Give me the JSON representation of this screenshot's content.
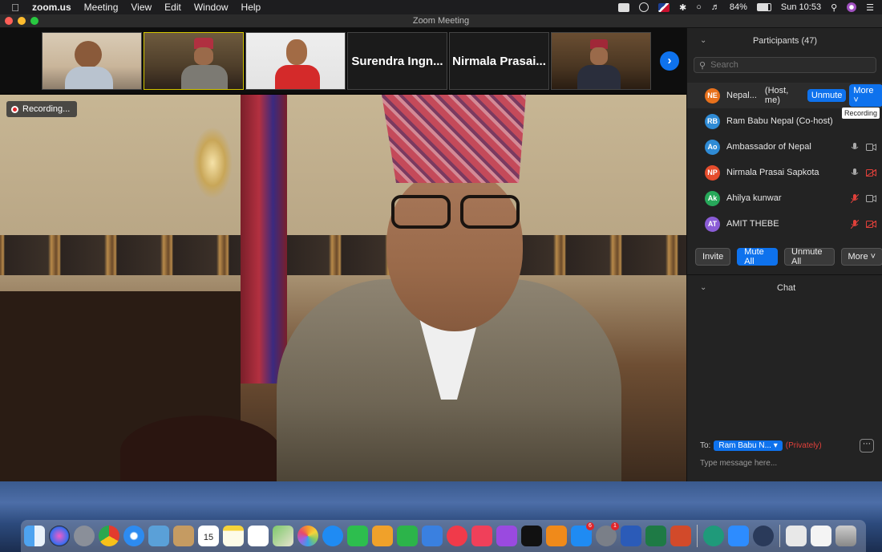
{
  "menubar": {
    "app": "zoom.us",
    "items": [
      "Meeting",
      "View",
      "Edit",
      "Window",
      "Help"
    ],
    "battery": "84%",
    "clock": "Sun 10:53"
  },
  "window": {
    "title": "Zoom Meeting"
  },
  "thumbnails": [
    {
      "label": ""
    },
    {
      "label": ""
    },
    {
      "label": ""
    },
    {
      "label": "Surendra Ingn..."
    },
    {
      "label": "Nirmala Prasai..."
    },
    {
      "label": ""
    }
  ],
  "recording": {
    "label": "Recording..."
  },
  "participants": {
    "header": "Participants (47)",
    "search_placeholder": "Search",
    "rows": [
      {
        "initials": "NE",
        "name": "Nepal...",
        "role": "(Host, me)",
        "color": "#e8711c"
      },
      {
        "initials": "RB",
        "name": "Ram Babu Nepal (Co-host)",
        "role": "",
        "color": "#2f8bd5"
      },
      {
        "initials": "Ao",
        "name": "Ambassador of Nepal",
        "role": "",
        "color": "#2f8bd5"
      },
      {
        "initials": "NP",
        "name": "Nirmala Prasai Sapkota",
        "role": "",
        "color": "#e54c2c"
      },
      {
        "initials": "Ak",
        "name": "Ahilya kunwar",
        "role": "",
        "color": "#27a85a"
      },
      {
        "initials": "AT",
        "name": "AMIT THEBE",
        "role": "",
        "color": "#8a5cd6"
      }
    ],
    "unmute_label": "Unmute",
    "more_label": "More",
    "tooltip": "Recording",
    "buttons": {
      "invite": "Invite",
      "mute_all": "Mute All",
      "unmute_all": "Unmute All",
      "more": "More"
    }
  },
  "chat": {
    "header": "Chat",
    "to_label": "To:",
    "recipient": "Ram Babu N...",
    "privately": "(Privately)",
    "placeholder": "Type message here..."
  },
  "dock": {
    "calendar_day": "15",
    "badges": {
      "appstore": "6",
      "settings": "1"
    }
  },
  "colors": {
    "accent": "#0e72ed",
    "panel": "#232323",
    "record": "#e0252a"
  }
}
